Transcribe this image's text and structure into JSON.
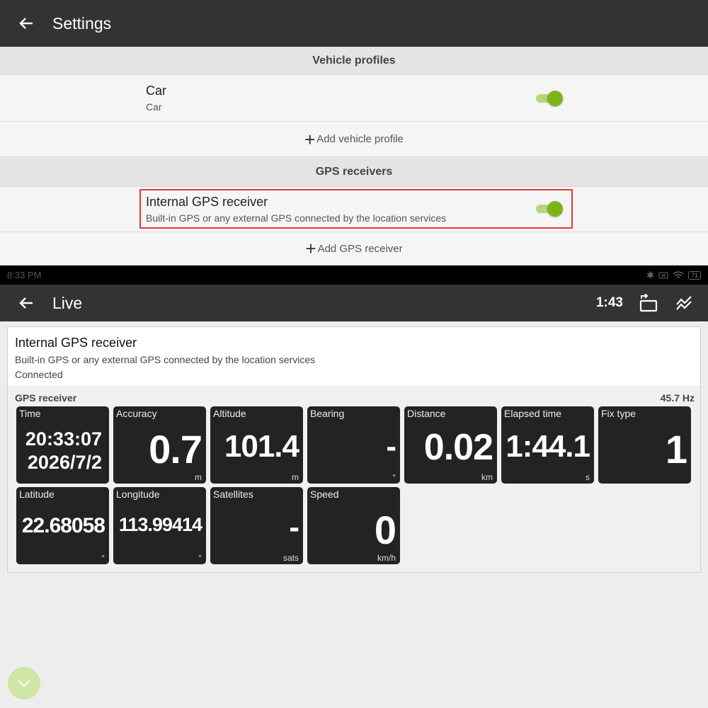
{
  "settings": {
    "title": "Settings",
    "vehicle_section": "Vehicle profiles",
    "vehicle": {
      "name": "Car",
      "sub": "Car",
      "enabled": true
    },
    "add_vehicle": "Add vehicle profile",
    "gps_section": "GPS receivers",
    "gps": {
      "name": "Internal GPS receiver",
      "sub": "Built-in GPS or any external GPS connected by the location services",
      "enabled": true
    },
    "add_gps": "Add GPS receiver"
  },
  "statusbar": {
    "time": "8:33 PM",
    "battery": "71"
  },
  "live": {
    "title": "Live",
    "timer": "1:43",
    "receiver": {
      "name": "Internal GPS receiver",
      "desc": "Built-in GPS or any external GPS connected by the location services",
      "status": "Connected"
    },
    "group_label": "GPS receiver",
    "rate": "45.7 Hz",
    "tiles": {
      "time": {
        "label": "Time",
        "line1": "20:33:07",
        "line2": "2026/7/2"
      },
      "accuracy": {
        "label": "Accuracy",
        "value": "0.7",
        "unit": "m"
      },
      "altitude": {
        "label": "Altitude",
        "value": "101.4",
        "unit": "m"
      },
      "bearing": {
        "label": "Bearing",
        "value": "-",
        "unit": "°"
      },
      "distance": {
        "label": "Distance",
        "value": "0.02",
        "unit": "km"
      },
      "elapsed": {
        "label": "Elapsed time",
        "value": "1:44.1",
        "unit": "s"
      },
      "fix": {
        "label": "Fix type",
        "value": "1",
        "unit": ""
      },
      "latitude": {
        "label": "Latitude",
        "value": "22.68058",
        "unit": "°"
      },
      "longitude": {
        "label": "Longitude",
        "value": "113.99414",
        "unit": "°"
      },
      "satellites": {
        "label": "Satellites",
        "value": "-",
        "unit": "sats"
      },
      "speed": {
        "label": "Speed",
        "value": "0",
        "unit": "km/h"
      }
    }
  },
  "colors": {
    "accent": "#7cb518",
    "appbar": "#333333",
    "tile": "#232323",
    "highlight": "#e03a3a"
  },
  "icons": [
    "back-arrow-icon",
    "plus-icon",
    "bluetooth-icon",
    "wifi-icon",
    "battery-icon",
    "rotate-screen-icon",
    "chart-icon",
    "chevron-down-icon"
  ]
}
